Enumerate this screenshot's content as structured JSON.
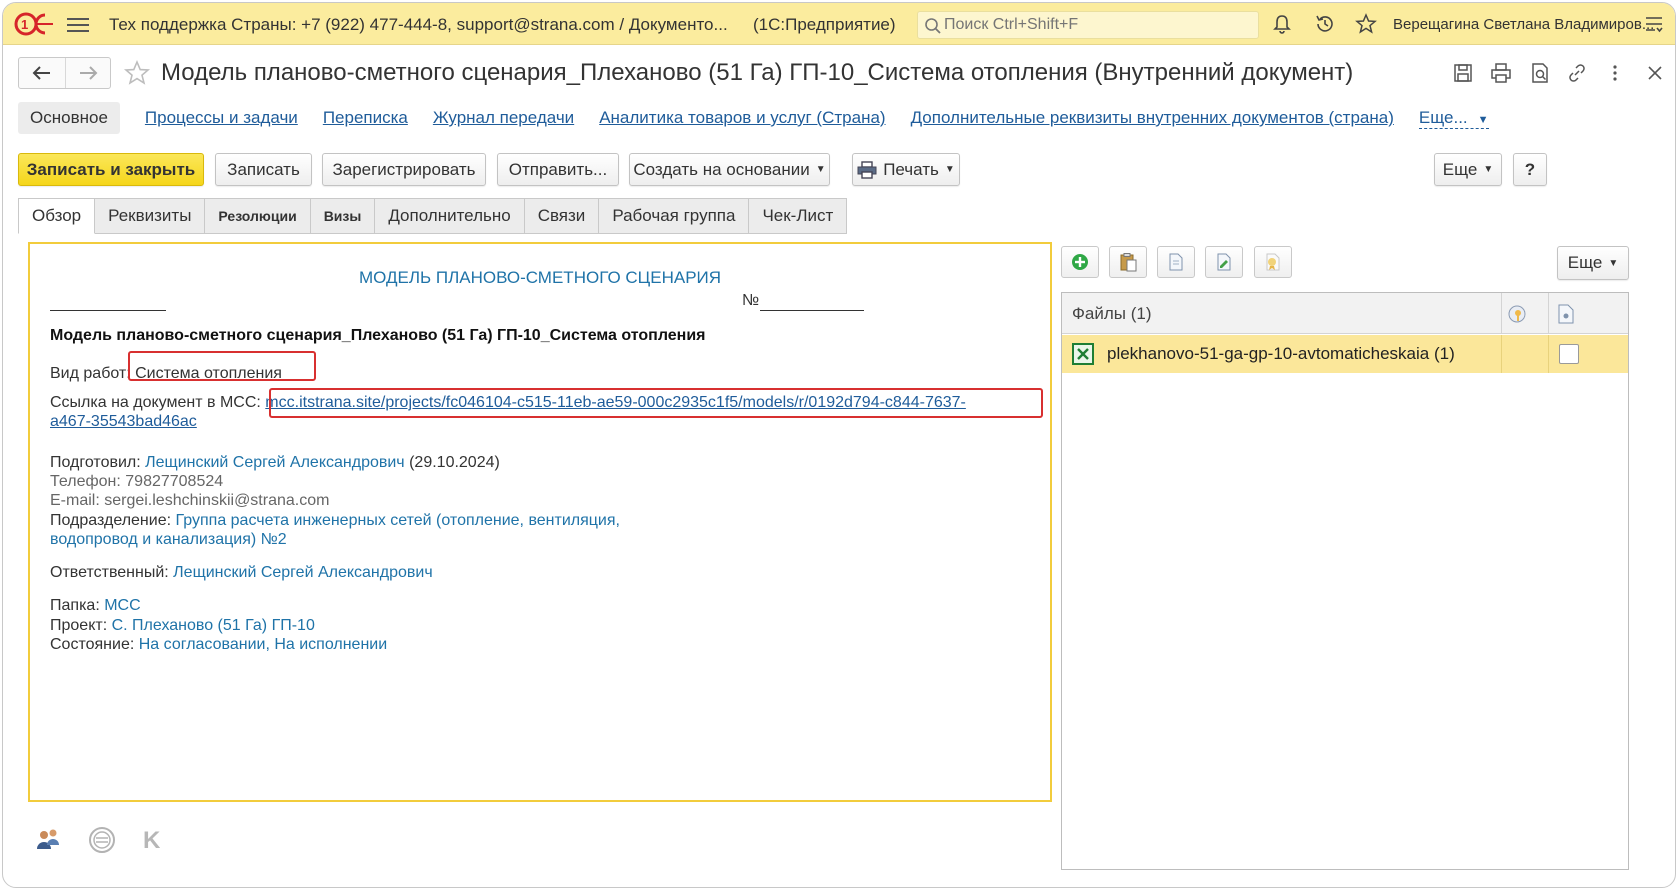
{
  "topbar": {
    "title": "Тех поддержка Страны: +7 (922) 477-444-8, support@strana.com / Документо...",
    "app_name": "(1С:Предприятие)",
    "search_placeholder": "Поиск Ctrl+Shift+F",
    "user": "Верещагина Светлана Владимиров...",
    "logo_text": "1С"
  },
  "titlebar": {
    "document_title": "Модель планово-сметного сценария_Плеханово (51 Га) ГП-10_Система отопления (Внутренний документ)"
  },
  "sections": {
    "active": "Основное",
    "links": [
      "Процессы и задачи",
      "Переписка",
      "Журнал передачи",
      "Аналитика товаров и услуг (Страна)",
      "Дополнительные реквизиты внутренних документов (страна)"
    ],
    "more": "Еще..."
  },
  "toolbar": {
    "save_close": "Записать и закрыть",
    "save": "Записать",
    "register": "Зарегистрировать",
    "send": "Отправить...",
    "create_based": "Создать на основании",
    "print": "Печать",
    "more": "Еще",
    "help": "?"
  },
  "tabs": [
    "Обзор",
    "Реквизиты",
    "Резолюции",
    "Визы",
    "Дополнительно",
    "Связи",
    "Рабочая группа",
    "Чек-Лист"
  ],
  "document": {
    "heading": "МОДЕЛЬ ПЛАНОВО-СМЕТНОГО СЦЕНАРИЯ",
    "number_label": "№",
    "name": "Модель планово-сметного сценария_Плеханово (51 Га) ГП-10_Система отопления",
    "work_type_label": "Вид работ:",
    "work_type_value": "Система отопления",
    "link_label": "Ссылка на документ в МСС:",
    "link_line1": "mcc.itstrana.site/projects/fc046104-c515-11eb-ae59-000c2935c1f5/models/r/0192d794-c844-7637-",
    "link_line2": "a467-35543bad46ac",
    "prepared_label": "Подготовил:",
    "prepared_name": "Лещинский Сергей Александрович",
    "prepared_date": "(29.10.2024)",
    "phone": "Телефон: 79827708524",
    "email": "E-mail: sergei.leshchinskii@strana.com",
    "department_label": "Подразделение:",
    "department_line1": "Группа расчета инженерных сетей (отопление, вентиляция,",
    "department_line2": "водопровод и канализация) №2",
    "responsible_label": "Ответственный:",
    "responsible_name": "Лещинский Сергей Александрович",
    "folder_label": "Папка:",
    "folder_value": "МСС",
    "project_label": "Проект:",
    "project_value": "С. Плеханово (51 Га) ГП-10",
    "state_label": "Состояние:",
    "state_value": "На согласовании, На исполнении"
  },
  "files": {
    "more": "Еще",
    "header": "Файлы (1)",
    "rows": [
      {
        "name": "plekhanovo-51-ga-gp-10-avtomaticheskaia (1)"
      }
    ]
  },
  "colors": {
    "topbar_bg": "#fbec9e",
    "primary_button": "#f5d61a",
    "link": "#1f5c9a",
    "highlight_box": "#d83030",
    "selected_row": "#fbe79a"
  }
}
